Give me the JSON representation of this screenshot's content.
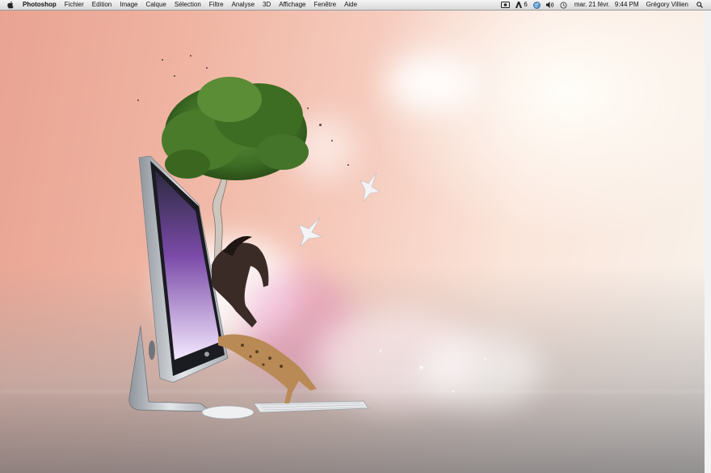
{
  "menubar": {
    "apple_icon": "apple-logo-icon",
    "app_name": "Photoshop",
    "menus": [
      "Fichier",
      "Edition",
      "Image",
      "Calque",
      "Sélection",
      "Filtre",
      "Analyse",
      "3D",
      "Affichage",
      "Fenêtre",
      "Aide"
    ],
    "status": {
      "adobe_count": "6",
      "date": "mar. 21 févr.",
      "time": "9:44 PM",
      "user": "Grégory Villien",
      "icons": [
        "screen-record-icon",
        "adobe-icon",
        "globe-icon",
        "volume-icon",
        "time-machine-icon",
        "spotlight-search-icon"
      ]
    }
  },
  "wallpaper": {
    "subject": [
      "imac-icon",
      "tree-icon",
      "horse-icon",
      "cheetah-icon",
      "dove-icon",
      "keyboard-icon",
      "mouse-icon"
    ],
    "colors": {
      "sky_left": "#e9a392",
      "sky_right": "#f8f3ec",
      "ground": "#8a8888"
    }
  }
}
